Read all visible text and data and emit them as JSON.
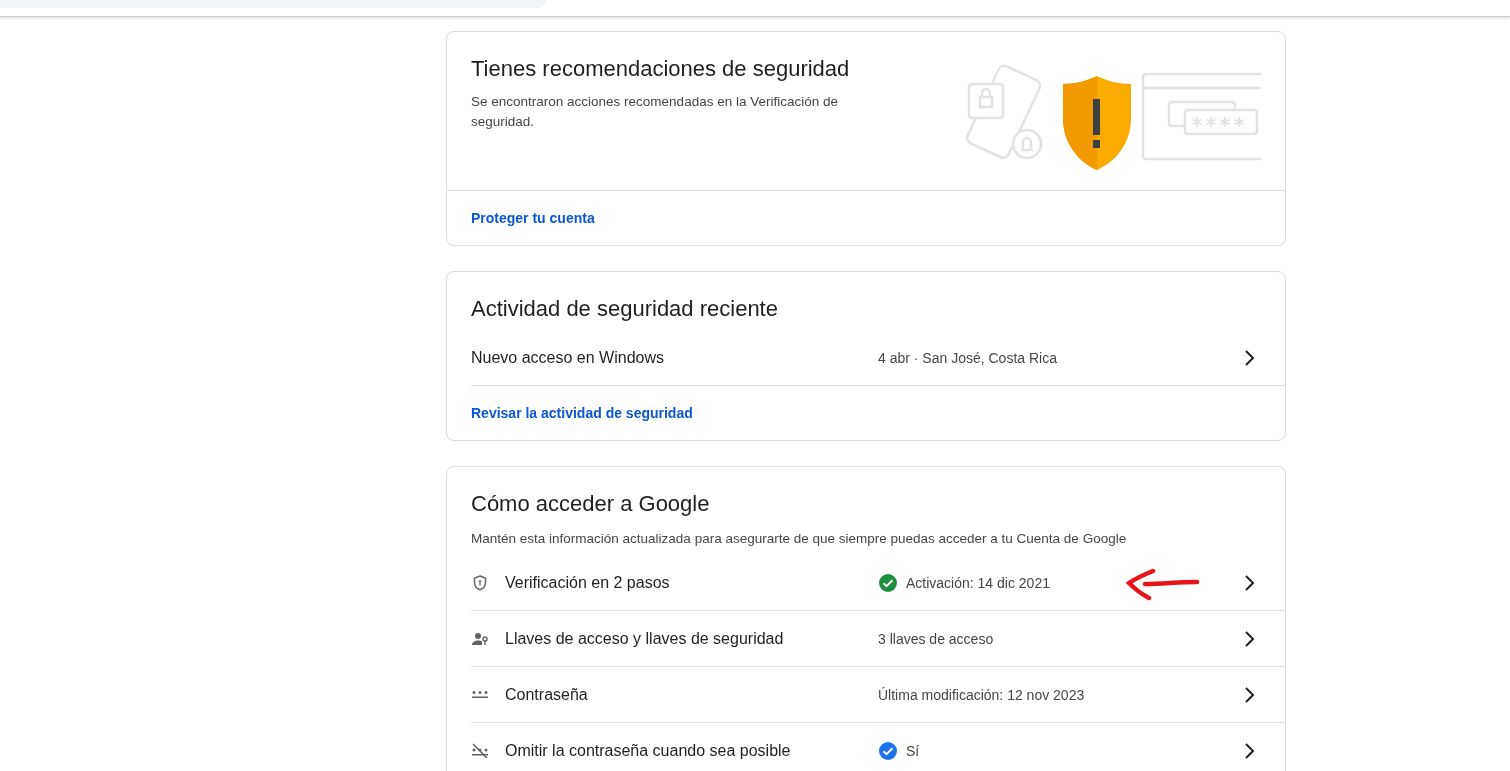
{
  "recommendations": {
    "title": "Tienes recomendaciones de seguridad",
    "description": "Se encontraron acciones recomendadas en la Verificación de seguridad.",
    "link": "Proteger tu cuenta"
  },
  "recent_activity": {
    "title": "Actividad de seguridad reciente",
    "events": [
      {
        "label": "Nuevo acceso en Windows",
        "detail": "4 abr · San José, Costa Rica"
      }
    ],
    "link": "Revisar la actividad de seguridad"
  },
  "sign_in": {
    "title": "Cómo acceder a Google",
    "description": "Mantén esta información actualizada para asegurarte de que siempre puedas acceder a tu Cuenta de Google",
    "rows": [
      {
        "kind": "shield",
        "label": "Verificación en 2 pasos",
        "value": "Activación: 14 dic 2021",
        "color": "#1e8e3e",
        "annotated": true
      },
      {
        "kind": "passkey",
        "label": "Llaves de acceso y llaves de seguridad",
        "value": "3 llaves de acceso",
        "annotated": false
      },
      {
        "kind": "password",
        "label": "Contraseña",
        "value": "Última modificación: 12 nov 2023",
        "annotated": false
      },
      {
        "kind": "skip",
        "label": "Omitir la contraseña cuando sea posible",
        "value": "Sí",
        "color": "#1a73e8",
        "annotated": false
      }
    ]
  }
}
